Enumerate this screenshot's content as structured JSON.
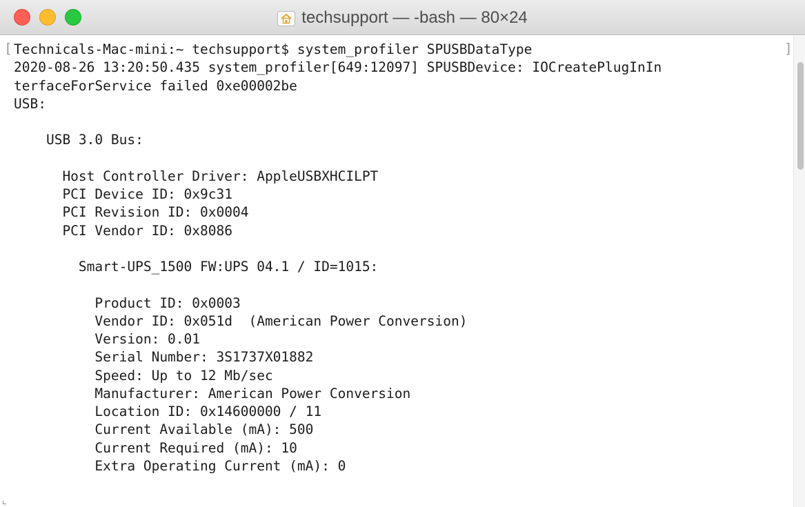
{
  "window": {
    "title": "techsupport — -bash — 80×24"
  },
  "terminal": {
    "lines": [
      "Technicals-Mac-mini:~ techsupport$ system_profiler SPUSBDataType",
      "2020-08-26 13:20:50.435 system_profiler[649:12097] SPUSBDevice: IOCreatePlugInIn",
      "terfaceForService failed 0xe00002be",
      "USB:",
      "",
      "    USB 3.0 Bus:",
      "",
      "      Host Controller Driver: AppleUSBXHCILPT",
      "      PCI Device ID: 0x9c31",
      "      PCI Revision ID: 0x0004",
      "      PCI Vendor ID: 0x8086",
      "",
      "        Smart-UPS_1500 FW:UPS 04.1 / ID=1015:",
      "",
      "          Product ID: 0x0003",
      "          Vendor ID: 0x051d  (American Power Conversion)",
      "          Version: 0.01",
      "          Serial Number: 3S1737X01882",
      "          Speed: Up to 12 Mb/sec",
      "          Manufacturer: American Power Conversion",
      "          Location ID: 0x14600000 / 11",
      "          Current Available (mA): 500",
      "          Current Required (mA): 10",
      "          Extra Operating Current (mA): 0"
    ],
    "edge_char": "E"
  },
  "colors": {
    "close": "#fe5f57",
    "minimize": "#febc2e",
    "zoom": "#28c840",
    "text": "#1c1c1c",
    "titlebar": "#e3e3e3"
  },
  "icons": {
    "title": "home-icon"
  }
}
